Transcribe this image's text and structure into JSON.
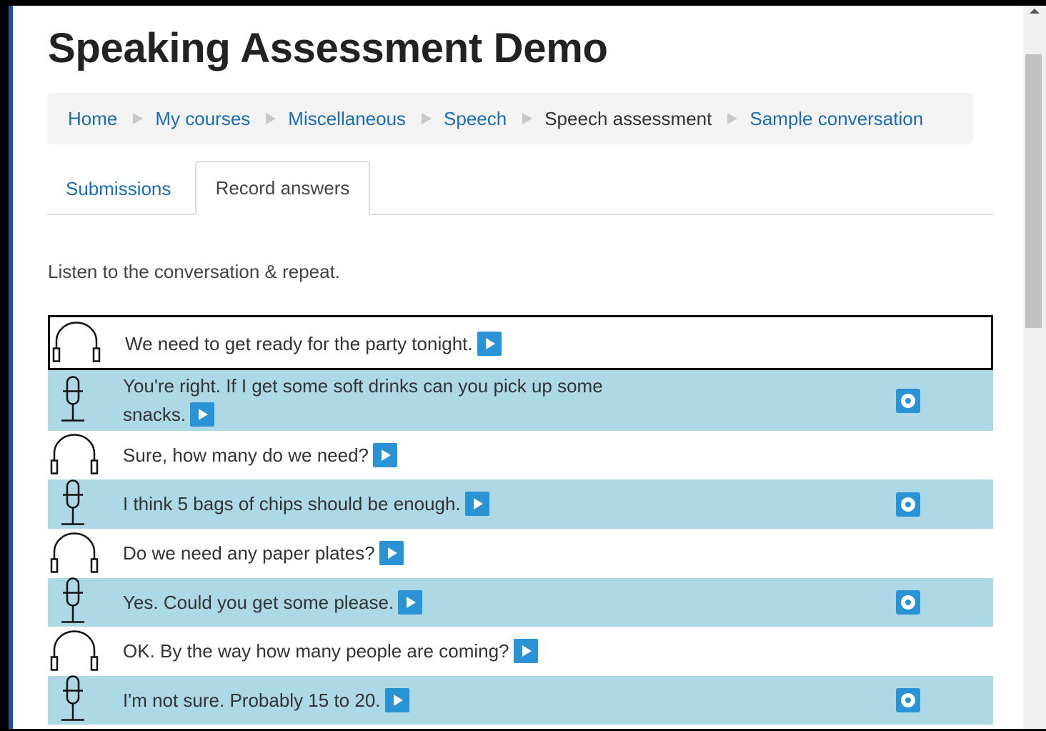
{
  "page": {
    "title": "Speaking Assessment Demo"
  },
  "breadcrumb": [
    {
      "label": "Home"
    },
    {
      "label": "My courses"
    },
    {
      "label": "Miscellaneous"
    },
    {
      "label": "Speech"
    },
    {
      "label": "Speech assessment"
    },
    {
      "label": "Sample conversation"
    }
  ],
  "tabs": [
    {
      "label": "Submissions"
    },
    {
      "label": "Record answers"
    }
  ],
  "instruction": "Listen to the conversation & repeat.",
  "conversation": [
    {
      "text": "We need to get ready for the party tonight.",
      "role": "listen",
      "icon": "headphones-icon"
    },
    {
      "text": "You're right. If I get some soft drinks can you pick up some",
      "text2": "snacks.",
      "role": "speak",
      "icon": "microphone-icon"
    },
    {
      "text": "Sure, how many do we need?",
      "role": "listen",
      "icon": "headphones-icon"
    },
    {
      "text": "I think 5 bags of chips should be enough.",
      "role": "speak",
      "icon": "microphone-icon"
    },
    {
      "text": "Do we need any paper plates?",
      "role": "listen",
      "icon": "headphones-icon"
    },
    {
      "text": "Yes. Could you get some please.",
      "role": "speak",
      "icon": "microphone-icon"
    },
    {
      "text": "OK. By the way how many people are coming?",
      "role": "listen",
      "icon": "headphones-icon"
    },
    {
      "text": "I'm not sure. Probably 15 to 20.",
      "role": "speak",
      "icon": "microphone-icon"
    }
  ],
  "colors": {
    "link": "#1a6cb3",
    "speak_row": "#add8e6",
    "button": "#2a93d5"
  }
}
